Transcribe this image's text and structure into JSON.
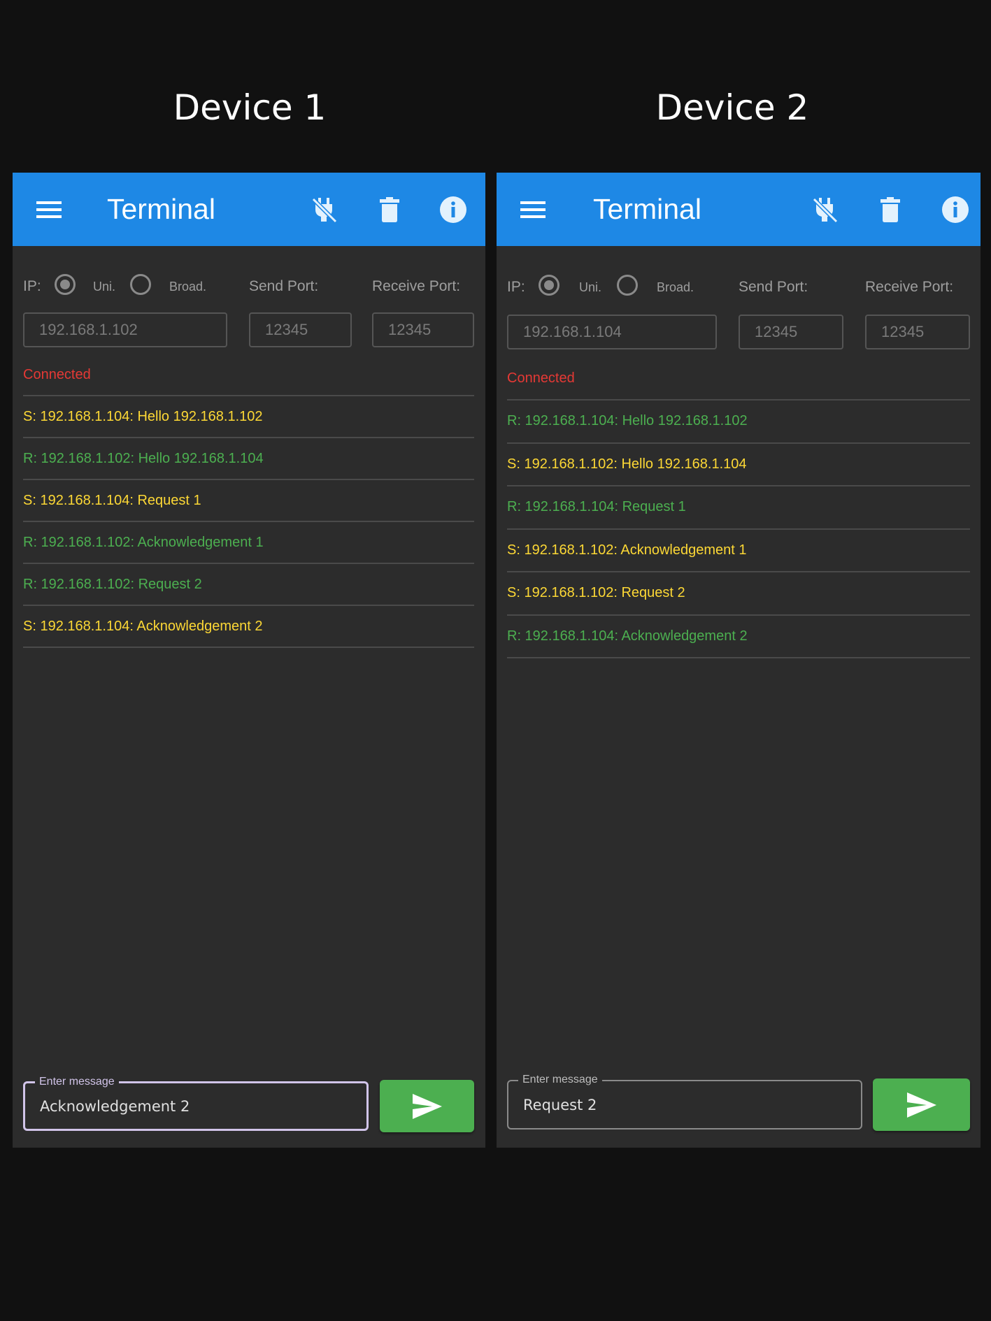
{
  "headings": {
    "device1": "Device 1",
    "device2": "Device 2"
  },
  "colors": {
    "appbar": "#1e88e5",
    "sent": "#fdd835",
    "received": "#4caf50",
    "status": "#e53935",
    "send_button": "#4caf50",
    "focused_field": "#d1c4e9"
  },
  "icons": {
    "menu": "hamburger-menu-icon",
    "disconnect": "power-plug-off-icon",
    "clear": "trash-icon",
    "info": "info-icon",
    "send": "send-arrow-icon"
  },
  "device1": {
    "title": "Terminal",
    "ip_label": "IP:",
    "uni_label": "Uni.",
    "broad_label": "Broad.",
    "mode_selected": "Uni.",
    "send_port_label": "Send Port:",
    "receive_port_label": "Receive Port:",
    "ip_value": "192.168.1.102",
    "send_port_value": "12345",
    "receive_port_value": "12345",
    "status": "Connected",
    "log": [
      {
        "text": "S: 192.168.1.104: Hello 192.168.1.102",
        "type": "sent"
      },
      {
        "text": "R: 192.168.1.102: Hello 192.168.1.104",
        "type": "recv"
      },
      {
        "text": "S: 192.168.1.104: Request 1",
        "type": "sent"
      },
      {
        "text": "R: 192.168.1.102: Acknowledgement 1",
        "type": "recv"
      },
      {
        "text": "R: 192.168.1.102: Request 2",
        "type": "recv"
      },
      {
        "text": "S: 192.168.1.104: Acknowledgement 2",
        "type": "sent"
      }
    ],
    "message_label": "Enter message",
    "message_value": "Acknowledgement 2"
  },
  "device2": {
    "title": "Terminal",
    "ip_label": "IP:",
    "uni_label": "Uni.",
    "broad_label": "Broad.",
    "mode_selected": "Uni.",
    "send_port_label": "Send Port:",
    "receive_port_label": "Receive Port:",
    "ip_value": "192.168.1.104",
    "send_port_value": "12345",
    "receive_port_value": "12345",
    "status": "Connected",
    "log": [
      {
        "text": "R: 192.168.1.104: Hello 192.168.1.102",
        "type": "recv"
      },
      {
        "text": "S: 192.168.1.102: Hello 192.168.1.104",
        "type": "sent"
      },
      {
        "text": "R: 192.168.1.104: Request 1",
        "type": "recv"
      },
      {
        "text": "S: 192.168.1.102: Acknowledgement 1",
        "type": "sent"
      },
      {
        "text": "S: 192.168.1.102: Request 2",
        "type": "sent"
      },
      {
        "text": "R: 192.168.1.104: Acknowledgement 2",
        "type": "recv"
      }
    ],
    "message_label": "Enter message",
    "message_value": "Request 2"
  }
}
